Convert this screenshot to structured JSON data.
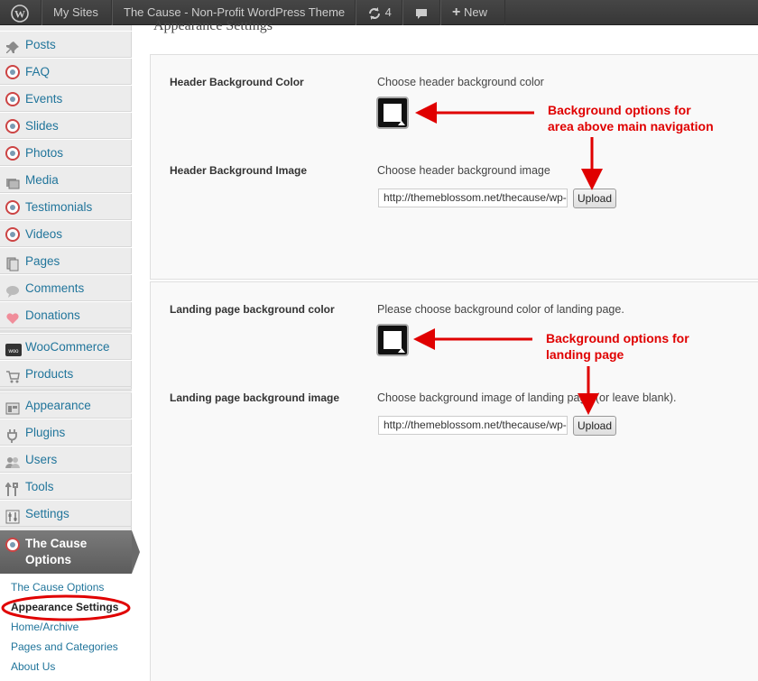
{
  "adminbar": {
    "my_sites": "My Sites",
    "site_name": "The Cause - Non-Profit WordPress Theme",
    "updates_count": "4",
    "new_label": "New"
  },
  "sidebar": {
    "items": [
      {
        "label": "Posts",
        "icon": "pushpin-icon"
      },
      {
        "label": "FAQ",
        "icon": "cause-icon"
      },
      {
        "label": "Events",
        "icon": "cause-icon"
      },
      {
        "label": "Slides",
        "icon": "cause-icon"
      },
      {
        "label": "Photos",
        "icon": "cause-icon"
      },
      {
        "label": "Media",
        "icon": "media-icon"
      },
      {
        "label": "Testimonials",
        "icon": "cause-icon"
      },
      {
        "label": "Videos",
        "icon": "cause-icon"
      },
      {
        "label": "Pages",
        "icon": "pages-icon"
      },
      {
        "label": "Comments",
        "icon": "comment-icon"
      },
      {
        "label": "Donations",
        "icon": "heart-icon"
      },
      {
        "label": "WooCommerce",
        "icon": "woo-icon"
      },
      {
        "label": "Products",
        "icon": "cart-icon"
      },
      {
        "label": "Appearance",
        "icon": "appearance-icon"
      },
      {
        "label": "Plugins",
        "icon": "plug-icon"
      },
      {
        "label": "Users",
        "icon": "users-icon"
      },
      {
        "label": "Tools",
        "icon": "tools-icon"
      },
      {
        "label": "Settings",
        "icon": "settings-icon"
      }
    ],
    "active_menu": {
      "line1": "The Cause",
      "line2": "Options"
    },
    "submenu": [
      "The Cause Options",
      "Appearance Settings",
      "Home/Archive",
      "Pages and Categories",
      "About Us"
    ]
  },
  "main": {
    "page_title": "Appearance Settings",
    "header_section": {
      "color_label": "Header Background Color",
      "color_desc": "Choose header background color",
      "image_label": "Header Background Image",
      "image_desc": "Choose header background image",
      "image_value": "http://themeblossom.net/thecause/wp-content/",
      "upload_label": "Upload"
    },
    "landing_section": {
      "color_label": "Landing page background color",
      "color_desc": "Please choose background color of landing page.",
      "image_label": "Landing page background image",
      "image_desc": "Choose background image of landing page (or leave blank).",
      "image_value": "http://themeblossom.net/thecause/wp-content/",
      "upload_label": "Upload"
    }
  },
  "annotations": {
    "header_line1": "Background options for",
    "header_line2": "area above main navigation",
    "landing_line1": "Background options for",
    "landing_line2": "landing page"
  },
  "colors": {
    "link": "#21759b",
    "annotation": "#e00000",
    "adminbar": "#464646",
    "swatch": "#111111"
  }
}
